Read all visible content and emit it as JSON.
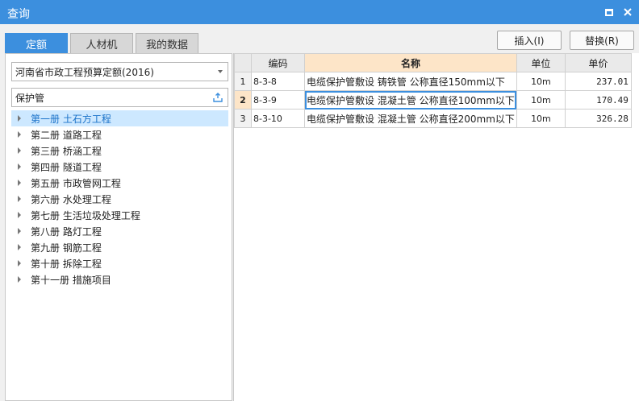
{
  "window": {
    "title": "查询"
  },
  "tabs": [
    {
      "label": "定额",
      "active": true
    },
    {
      "label": "人材机",
      "active": false
    },
    {
      "label": "我的数据",
      "active": false
    }
  ],
  "toolbar": {
    "insert_label": "插入(I)",
    "replace_label": "替换(R)"
  },
  "left": {
    "quota_library": "河南省市政工程预算定额(2016)",
    "search_value": "保护管",
    "tree": [
      {
        "label": "第一册 土石方工程"
      },
      {
        "label": "第二册 道路工程"
      },
      {
        "label": "第三册 桥涵工程"
      },
      {
        "label": "第四册 隧道工程"
      },
      {
        "label": "第五册 市政管网工程"
      },
      {
        "label": "第六册 水处理工程"
      },
      {
        "label": "第七册 生活垃圾处理工程"
      },
      {
        "label": "第八册 路灯工程"
      },
      {
        "label": "第九册 钢筋工程"
      },
      {
        "label": "第十册 拆除工程"
      },
      {
        "label": "第十一册 措施项目"
      }
    ]
  },
  "grid": {
    "headers": {
      "code": "编码",
      "name": "名称",
      "unit": "单位",
      "price": "单价"
    },
    "rows": [
      {
        "num": "1",
        "code": "8-3-8",
        "name": "电缆保护管敷设 铸铁管 公称直径150mm以下",
        "unit": "10m",
        "price": "237.01"
      },
      {
        "num": "2",
        "code": "8-3-9",
        "name": "电缆保护管敷设 混凝土管 公称直径100mm以下",
        "unit": "10m",
        "price": "170.49"
      },
      {
        "num": "3",
        "code": "8-3-10",
        "name": "电缆保护管敷设 混凝土管 公称直径200mm以下",
        "unit": "10m",
        "price": "326.28"
      }
    ]
  },
  "colors": {
    "accent": "#3c8fde",
    "selection": "#cde8ff",
    "header_highlight": "#fde5c8"
  }
}
